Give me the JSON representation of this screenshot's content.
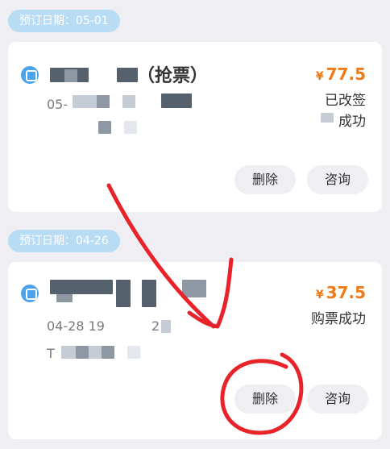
{
  "orders": [
    {
      "date_label": "预订日期：05-01",
      "title_partial": "（抢票）",
      "time_partial": "05-",
      "price_symbol": "¥",
      "price": "77.5",
      "status_line1": "已改签",
      "status_line2": "成功",
      "delete_label": "删除",
      "consult_label": "咨询"
    },
    {
      "date_label": "预订日期：04-26",
      "time_partial": "04-28 19",
      "time_partial2": "2",
      "passenger_partial": "T",
      "price_symbol": "¥",
      "price": "37.5",
      "status": "购票成功",
      "delete_label": "删除",
      "consult_label": "咨询"
    }
  ],
  "annotation_color": "#e8232a"
}
